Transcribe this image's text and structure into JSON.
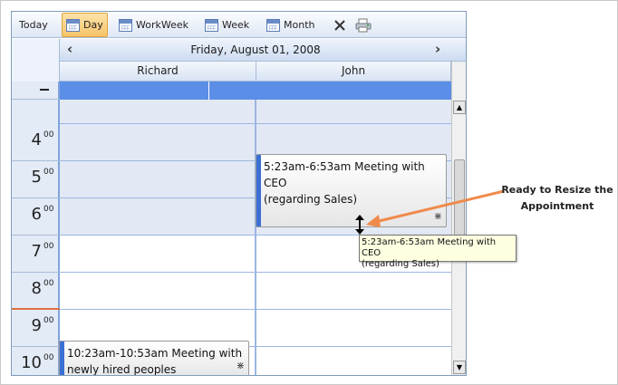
{
  "toolbar": {
    "today": "Today",
    "day": "Day",
    "workweek": "WorkWeek",
    "week": "Week",
    "month": "Month",
    "delete_icon": "close-icon",
    "print_icon": "printer-icon"
  },
  "nav": {
    "date": "Friday, August 01, 2008",
    "prev": "‹",
    "next": "›"
  },
  "resources": [
    "Richard",
    "John"
  ],
  "hours": [
    {
      "label": "4",
      "sup": "00"
    },
    {
      "label": "5",
      "sup": "00"
    },
    {
      "label": "6",
      "sup": "00"
    },
    {
      "label": "7",
      "sup": "00"
    },
    {
      "label": "8",
      "sup": "00"
    },
    {
      "label": "9",
      "sup": "00"
    },
    {
      "label": "10",
      "sup": "00"
    }
  ],
  "appointments": {
    "john": "5:23am-6:53am Meeting with\nCEO\n(regarding Sales)",
    "richard": "10:23am-10:53am Meeting with\nnewly hired peoples"
  },
  "tooltip": {
    "line1": "5:23am-6:53am Meeting with CEO",
    "line2": "(regarding Sales)"
  },
  "callout": "Ready to Resize the\nAppointment",
  "colors": {
    "accent": "#5b8ee6",
    "callout_arrow": "#f08a4b",
    "appointment_bar": "#3a6fd4"
  }
}
